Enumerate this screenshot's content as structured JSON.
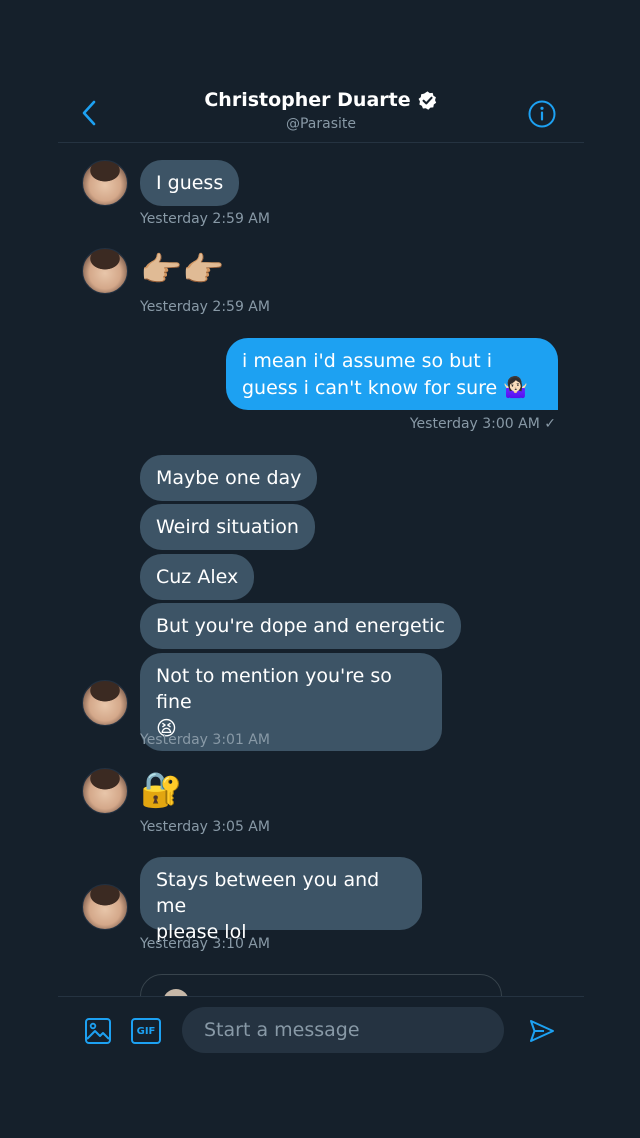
{
  "header": {
    "title": "Christopher Duarte",
    "handle": "@Parasite"
  },
  "messages": [
    {
      "text": "I guess",
      "time": "Yesterday 2:59 AM"
    },
    {
      "emoji": "👉🏼👉🏼",
      "time": "Yesterday 2:59 AM"
    },
    {
      "text": "i mean i'd assume so but i guess i can't know for sure",
      "emoji": "🤷🏻‍♀️",
      "time": "Yesterday 3:00 AM ✓"
    },
    {
      "text": "Maybe one day"
    },
    {
      "text": "Weird situation"
    },
    {
      "text": "Cuz Alex"
    },
    {
      "text": "But you're dope and energetic"
    },
    {
      "text": "Not to mention you're so fine",
      "emoji": "😫",
      "time": "Yesterday 3:01 AM"
    },
    {
      "emoji": "🔐",
      "time": "Yesterday 3:05 AM"
    },
    {
      "text_line1": "Stays between you and me",
      "text_line2": "please lol",
      "time": "Yesterday 3:10 AM"
    }
  ],
  "composer": {
    "placeholder": "Start a message",
    "gif_label": "GIF"
  },
  "colors": {
    "background": "#15202b",
    "incoming_bubble": "#3d5466",
    "outgoing_bubble": "#1da1f2",
    "accent": "#1da1f2",
    "muted_text": "#8899a6"
  },
  "icons": {
    "back": "chevron-left-icon",
    "info": "info-icon",
    "verified": "verified-badge-icon",
    "media": "image-icon",
    "gif": "gif-icon",
    "send": "send-icon"
  }
}
